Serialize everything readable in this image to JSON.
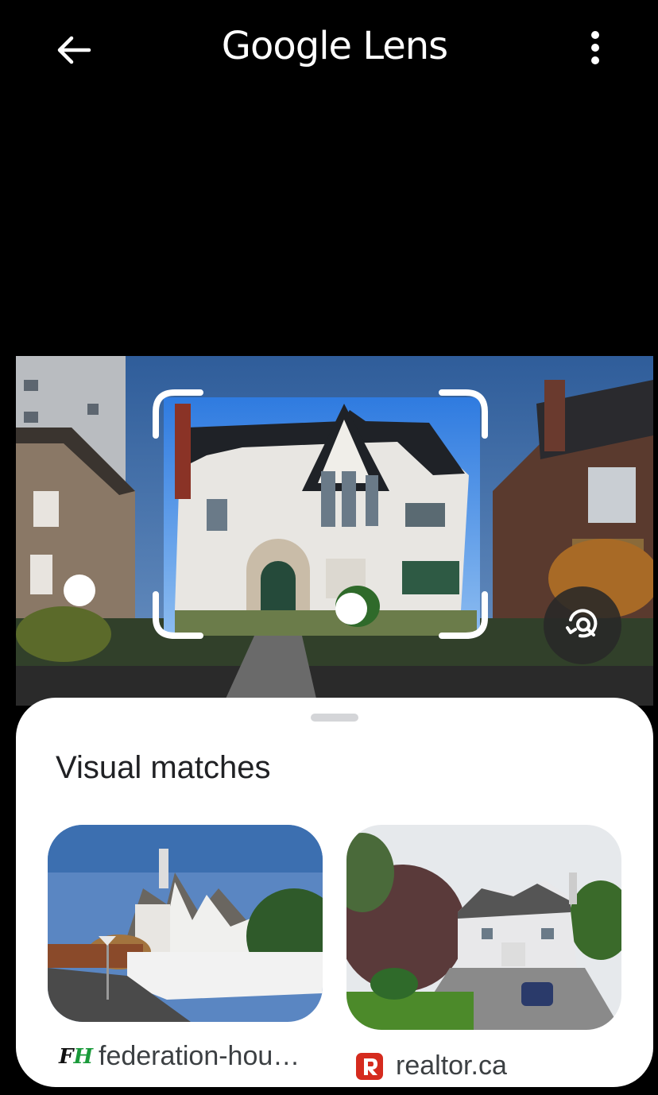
{
  "header": {
    "title": "Google Lens"
  },
  "icons": {
    "back": "arrow-left-icon",
    "more": "more-vert-icon",
    "lens": "lens-search-icon"
  },
  "sheet": {
    "title": "Visual matches",
    "results": [
      {
        "source": "federation-hou…",
        "logo": "FH"
      },
      {
        "source": "realtor.ca",
        "logo": "R"
      }
    ]
  },
  "colors": {
    "background": "#000000",
    "sheet": "#ffffff",
    "text": "#202124",
    "realtor_red": "#d52b1e",
    "fh_green": "#1a9a3a"
  }
}
